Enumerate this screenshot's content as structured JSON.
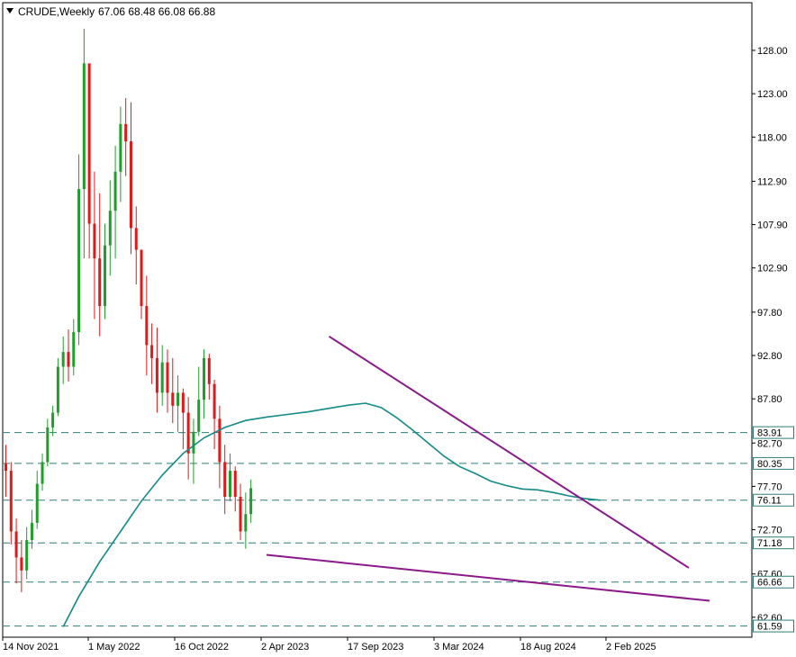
{
  "header": {
    "symbol": "CRUDE,Weekly",
    "ohlc": "67.06 68.48 66.08 66.88"
  },
  "chart_data": {
    "type": "candlestick",
    "symbol": "CRUDE",
    "timeframe": "Weekly",
    "last_bar": {
      "open": 67.06,
      "high": 68.48,
      "low": 66.08,
      "close": 66.88
    },
    "ylim": [
      60.3,
      133.5
    ],
    "y_ticks": [
      128.0,
      123.0,
      118.0,
      112.9,
      107.9,
      102.9,
      97.8,
      92.8,
      87.8,
      82.7,
      77.7,
      72.7,
      67.6,
      62.6
    ],
    "y_tick_labels": [
      "128.00",
      "123.00",
      "118.00",
      "112.90",
      "107.90",
      "102.90",
      "97.80",
      "92.80",
      "87.80",
      "82.70",
      "77.70",
      "72.70",
      "67.60",
      "62.60"
    ],
    "x_tick_labels": [
      "14 Nov 2021",
      "1 May 2022",
      "16 Oct 2022",
      "2 Apr 2023",
      "17 Sep 2023",
      "3 Mar 2024",
      "18 Aug 2024",
      "2 Feb 2025"
    ],
    "levels": [
      {
        "value": 83.91,
        "label": "83.91"
      },
      {
        "value": 80.35,
        "label": "80.35"
      },
      {
        "value": 76.11,
        "label": "76.11"
      },
      {
        "value": 71.18,
        "label": "71.18"
      },
      {
        "value": 66.66,
        "label": "66.66"
      },
      {
        "value": 61.59,
        "label": "61.59"
      }
    ],
    "trendlines": [
      {
        "name": "resistance",
        "from": {
          "week": 62,
          "price": 95.0
        },
        "to": {
          "week": 131,
          "price": 68.3
        }
      },
      {
        "name": "support",
        "from": {
          "week": 50,
          "price": 69.8
        },
        "to": {
          "week": 135,
          "price": 64.5
        }
      }
    ],
    "moving_average": [
      [
        11,
        61.5
      ],
      [
        14,
        65
      ],
      [
        18,
        69
      ],
      [
        22,
        72.5
      ],
      [
        26,
        76
      ],
      [
        30,
        79
      ],
      [
        34,
        81.5
      ],
      [
        38,
        83.3
      ],
      [
        42,
        84.5
      ],
      [
        46,
        85.3
      ],
      [
        50,
        85.7
      ],
      [
        54,
        86
      ],
      [
        58,
        86.3
      ],
      [
        62,
        86.7
      ],
      [
        66,
        87.1
      ],
      [
        69,
        87.3
      ],
      [
        72,
        86.8
      ],
      [
        75,
        85.6
      ],
      [
        78,
        84.2
      ],
      [
        81,
        82.7
      ],
      [
        84,
        81.2
      ],
      [
        87,
        80
      ],
      [
        90,
        79.2
      ],
      [
        93,
        78.3
      ],
      [
        96,
        77.8
      ],
      [
        99,
        77.4
      ],
      [
        102,
        77.3
      ],
      [
        105,
        77
      ],
      [
        108,
        76.6
      ],
      [
        111,
        76.3
      ],
      [
        114,
        76.1
      ]
    ],
    "candles": [
      [
        0,
        80.3,
        79.5,
        82.5,
        76.5
      ],
      [
        1,
        79.5,
        72.5,
        80.5,
        71
      ],
      [
        2,
        72.5,
        69.5,
        74,
        66.5
      ],
      [
        3,
        69.5,
        68,
        71.5,
        65.5
      ],
      [
        4,
        68,
        71.5,
        73,
        67
      ],
      [
        5,
        71.5,
        73.5,
        75,
        70.5
      ],
      [
        6,
        73.5,
        78,
        79.5,
        72.8
      ],
      [
        7,
        78,
        80.5,
        81.5,
        77.2
      ],
      [
        8,
        80.5,
        84.5,
        85.5,
        80
      ],
      [
        9,
        84.5,
        86.2,
        87,
        83.5
      ],
      [
        10,
        86.2,
        91.5,
        92.5,
        85.8
      ],
      [
        11,
        91.5,
        93.2,
        95,
        89.5
      ],
      [
        12,
        93.2,
        91.5,
        95.8,
        89.8
      ],
      [
        13,
        91.5,
        95.5,
        97,
        90.5
      ],
      [
        14,
        95.5,
        112,
        116,
        94
      ],
      [
        15,
        112,
        126.5,
        130.5,
        104
      ],
      [
        16,
        126.5,
        108,
        115,
        104
      ],
      [
        17,
        108,
        104,
        114,
        97
      ],
      [
        18,
        104,
        98.5,
        111.5,
        95
      ],
      [
        19,
        98.5,
        105.5,
        108,
        97
      ],
      [
        20,
        105.5,
        109.5,
        113,
        102
      ],
      [
        21,
        109.5,
        114,
        117,
        104
      ],
      [
        22,
        114,
        119.5,
        121.5,
        110.5
      ],
      [
        23,
        119.5,
        117.5,
        122.5,
        113.5
      ],
      [
        24,
        117.5,
        107.5,
        122,
        104.5
      ],
      [
        25,
        107.5,
        105,
        110,
        101
      ],
      [
        26,
        105,
        98.5,
        104.5,
        97
      ],
      [
        27,
        98.5,
        94,
        102,
        90.5
      ],
      [
        28,
        94,
        92.5,
        96.5,
        89.5
      ],
      [
        29,
        92.5,
        88.5,
        96,
        86.2
      ],
      [
        30,
        88.5,
        92,
        94,
        87
      ],
      [
        31,
        92,
        88.5,
        93.5,
        86.2
      ],
      [
        32,
        88.5,
        87,
        92.5,
        85
      ],
      [
        33,
        87,
        88.5,
        90.5,
        84
      ],
      [
        34,
        88.5,
        86.2,
        89,
        82
      ],
      [
        35,
        86.2,
        81.5,
        88,
        78.5
      ],
      [
        36,
        81.5,
        84,
        85.5,
        78
      ],
      [
        37,
        84,
        87.7,
        91.5,
        83.5
      ],
      [
        38,
        87.7,
        92.5,
        93.5,
        85.5
      ],
      [
        39,
        92.5,
        89.5,
        93,
        87.7
      ],
      [
        40,
        89.5,
        85.5,
        90,
        82
      ],
      [
        41,
        85.5,
        80.5,
        87,
        77.5
      ],
      [
        42,
        80.5,
        76.5,
        82.5,
        74.5
      ],
      [
        43,
        76.5,
        79.5,
        81.5,
        76
      ],
      [
        44,
        79.5,
        76.5,
        80,
        74.8
      ],
      [
        45,
        76.5,
        72.5,
        78,
        71.5
      ],
      [
        46,
        72.5,
        74.5,
        77,
        70.5
      ],
      [
        47,
        74.5,
        77.5,
        78.5,
        73.5
      ]
    ]
  }
}
